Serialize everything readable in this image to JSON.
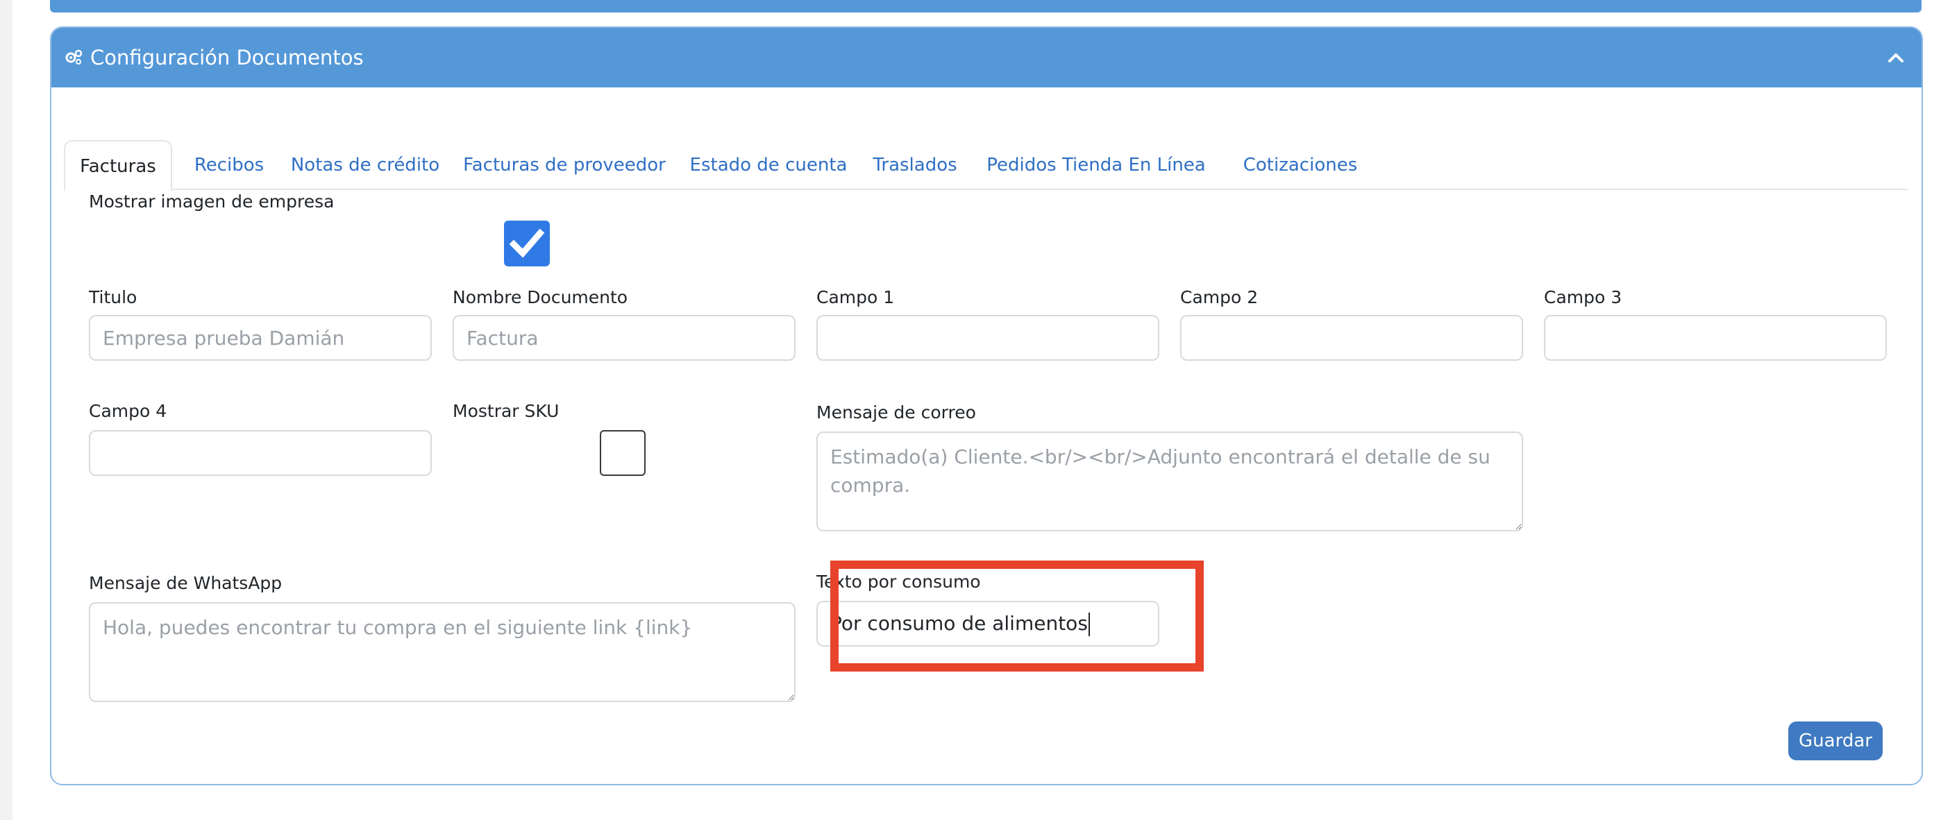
{
  "header": {
    "title": "Configuración Documentos",
    "icon": "gears-icon",
    "toggle_icon": "chevron-up-icon"
  },
  "tabs": [
    {
      "label": "Facturas",
      "active": true
    },
    {
      "label": "Recibos"
    },
    {
      "label": "Notas de crédito"
    },
    {
      "label": "Facturas de proveedor"
    },
    {
      "label": "Estado de cuenta"
    },
    {
      "label": "Traslados"
    },
    {
      "label": "Pedidos Tienda En Línea"
    },
    {
      "label": "Cotizaciones"
    }
  ],
  "form": {
    "show_logo": {
      "label": "Mostrar imagen de empresa",
      "checked": true
    },
    "titulo": {
      "label": "Titulo",
      "placeholder": "Empresa prueba Damián",
      "value": ""
    },
    "nombre_documento": {
      "label": "Nombre Documento",
      "placeholder": "Factura",
      "value": ""
    },
    "campo1": {
      "label": "Campo 1",
      "value": ""
    },
    "campo2": {
      "label": "Campo 2",
      "value": ""
    },
    "campo3": {
      "label": "Campo 3",
      "value": ""
    },
    "campo4": {
      "label": "Campo 4",
      "value": ""
    },
    "show_sku": {
      "label": "Mostrar SKU",
      "checked": false
    },
    "mensaje_correo": {
      "label": "Mensaje de correo",
      "placeholder": "Estimado(a) Cliente.<br/><br/>Adjunto encontrará el detalle de su compra."
    },
    "mensaje_whatsapp": {
      "label": "Mensaje de WhatsApp",
      "placeholder": "Hola, puedes encontrar tu compra en el siguiente link {link}"
    },
    "texto_consumo": {
      "label": "Texto por consumo",
      "value": "Por consumo de alimentos"
    }
  },
  "actions": {
    "save_label": "Guardar"
  },
  "colors": {
    "header_bg": "#5598d8",
    "highlight": "#e8432b",
    "checkbox": "#2f7ae5",
    "save_button": "#3f7ac2"
  }
}
